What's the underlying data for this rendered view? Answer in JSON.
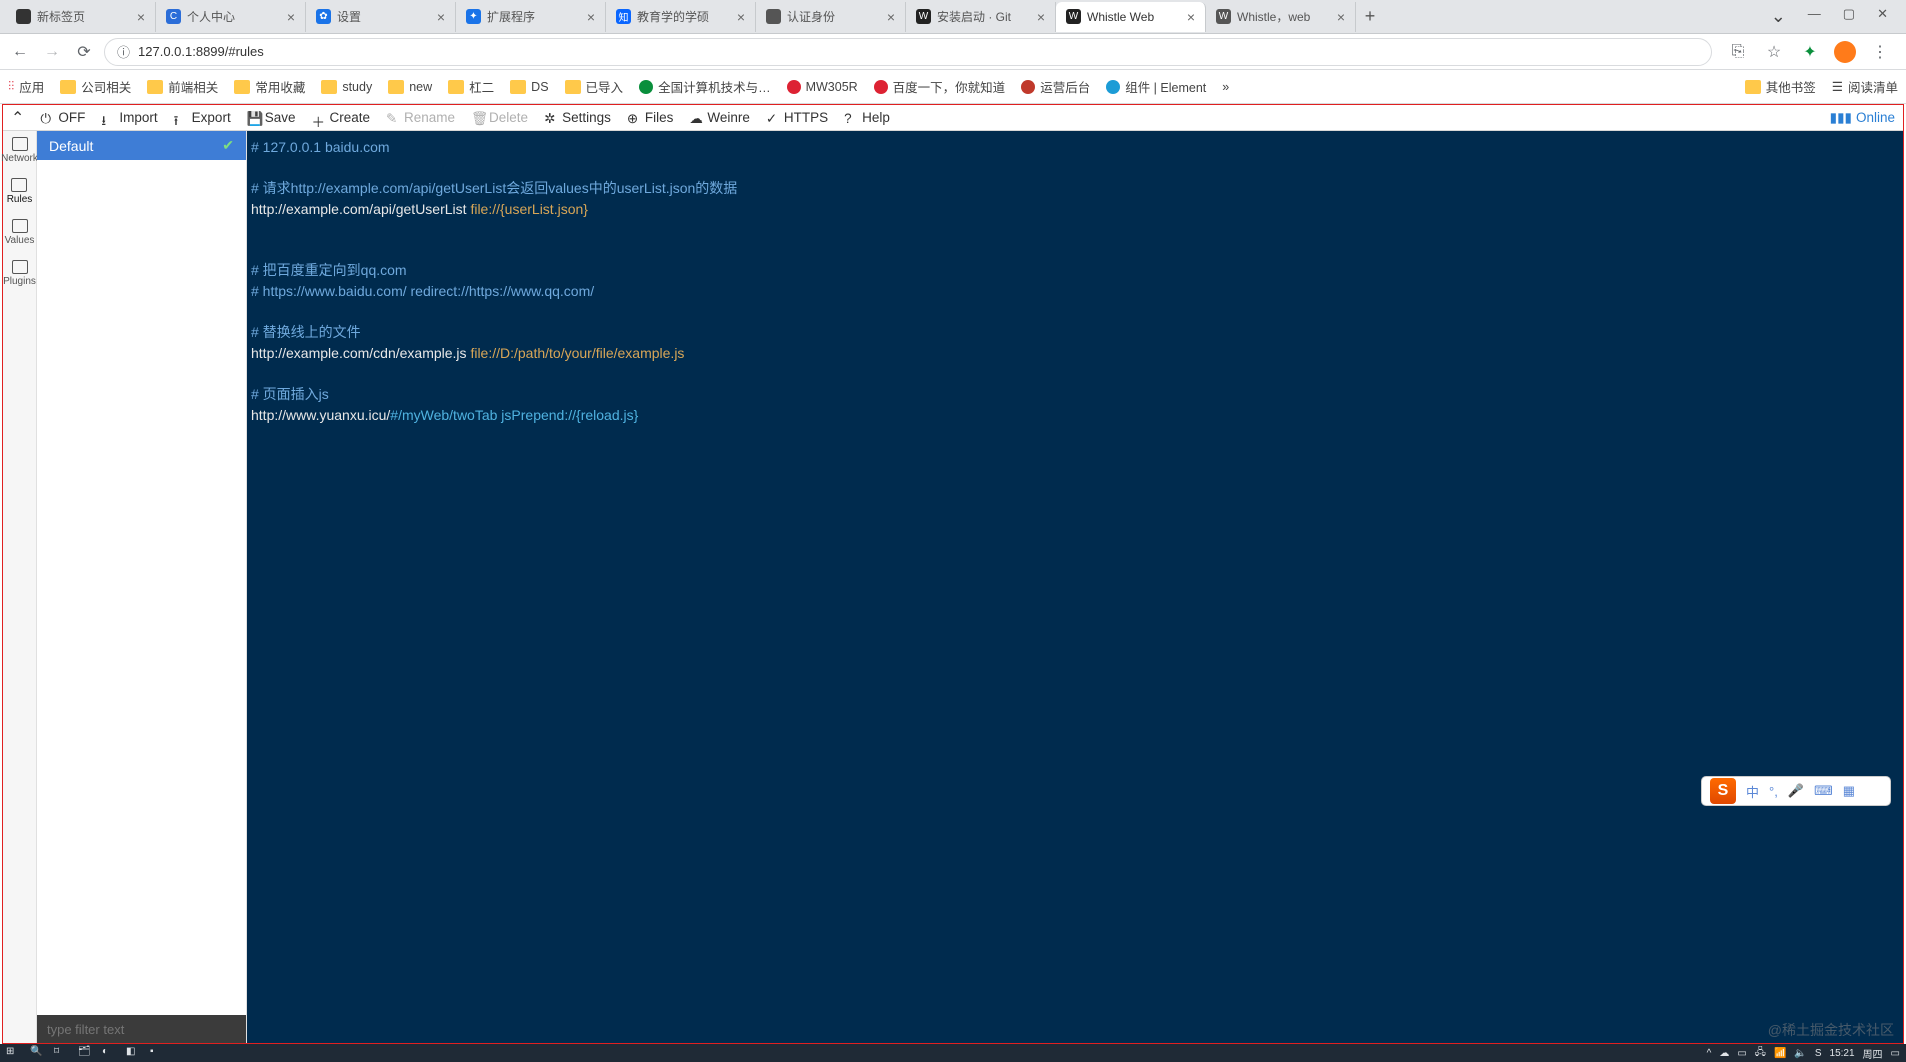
{
  "browser": {
    "tabs": [
      {
        "label": "新标签页",
        "fav_bg": "#333",
        "fav_txt": ""
      },
      {
        "label": "个人中心",
        "fav_bg": "#2b6dd8",
        "fav_txt": "C"
      },
      {
        "label": "设置",
        "fav_bg": "#1a73e8",
        "fav_txt": "✿"
      },
      {
        "label": "扩展程序",
        "fav_bg": "#1a73e8",
        "fav_txt": "✦"
      },
      {
        "label": "教育学的学硕",
        "fav_bg": "#0a66ff",
        "fav_txt": "知"
      },
      {
        "label": "认证身份",
        "fav_bg": "#555",
        "fav_txt": ""
      },
      {
        "label": "安装启动 · Git",
        "fav_bg": "#222",
        "fav_txt": "W"
      },
      {
        "label": "Whistle Web",
        "fav_bg": "#222",
        "fav_txt": "W",
        "active": true
      },
      {
        "label": "Whistle，web",
        "fav_bg": "#555",
        "fav_txt": "W"
      }
    ],
    "url": "127.0.0.1:8899/#rules",
    "bookmarks_left": [
      {
        "label": "应用",
        "type": "apps"
      },
      {
        "label": "公司相关",
        "type": "folder"
      },
      {
        "label": "前端相关",
        "type": "folder"
      },
      {
        "label": "常用收藏",
        "type": "folder"
      },
      {
        "label": "study",
        "type": "folder"
      },
      {
        "label": "new",
        "type": "folder"
      },
      {
        "label": "杠二",
        "type": "folder"
      },
      {
        "label": "DS",
        "type": "folder"
      },
      {
        "label": "已导入",
        "type": "folder"
      },
      {
        "label": "全国计算机技术与…",
        "type": "site",
        "color": "#0a8f3c"
      },
      {
        "label": "MW305R",
        "type": "site",
        "color": "#d23"
      },
      {
        "label": "百度一下，你就知道",
        "type": "site",
        "color": "#d23"
      },
      {
        "label": "运营后台",
        "type": "site",
        "color": "#c0392b"
      },
      {
        "label": "组件 | Element",
        "type": "site",
        "color": "#1c9cd6"
      }
    ],
    "bookmarks_right": [
      {
        "label": "其他书签",
        "type": "folder"
      },
      {
        "label": "阅读清单",
        "type": "list"
      }
    ],
    "overflow": "»"
  },
  "whistle": {
    "toolbar": [
      {
        "key": "off",
        "label": "OFF",
        "enabled": true
      },
      {
        "key": "import",
        "label": "Import",
        "enabled": true
      },
      {
        "key": "export",
        "label": "Export",
        "enabled": true
      },
      {
        "key": "save",
        "label": "Save",
        "enabled": true
      },
      {
        "key": "create",
        "label": "Create",
        "enabled": true
      },
      {
        "key": "rename",
        "label": "Rename",
        "enabled": false
      },
      {
        "key": "delete",
        "label": "Delete",
        "enabled": false
      },
      {
        "key": "settings",
        "label": "Settings",
        "enabled": true
      },
      {
        "key": "files",
        "label": "Files",
        "enabled": true
      },
      {
        "key": "weinre",
        "label": "Weinre",
        "enabled": true
      },
      {
        "key": "https",
        "label": "HTTPS",
        "enabled": true
      },
      {
        "key": "help",
        "label": "Help",
        "enabled": true
      }
    ],
    "online_label": "Online",
    "vtabs": [
      {
        "label": "Network"
      },
      {
        "label": "Rules",
        "active": true
      },
      {
        "label": "Values"
      },
      {
        "label": "Plugins"
      }
    ],
    "rules": [
      {
        "name": "Default",
        "active": true,
        "checked": true
      }
    ],
    "filter_placeholder": "type filter text",
    "editor_lines": [
      {
        "t": "comment",
        "text": "# 127.0.0.1 baidu.com"
      },
      {
        "t": "blank",
        "text": ""
      },
      {
        "t": "comment",
        "text": "# 请求http://example.com/api/getUserList会返回values中的userList.json的数据"
      },
      {
        "t": "rule",
        "url": "http://example.com/api/getUserList ",
        "op": "file://{userList.json}"
      },
      {
        "t": "blank",
        "text": ""
      },
      {
        "t": "blank",
        "text": ""
      },
      {
        "t": "comment",
        "text": "# 把百度重定向到qq.com"
      },
      {
        "t": "comment",
        "text": "# https://www.baidu.com/ redirect://https://www.qq.com/"
      },
      {
        "t": "blank",
        "text": ""
      },
      {
        "t": "comment",
        "text": "# 替换线上的文件"
      },
      {
        "t": "rule",
        "url": "http://example.com/cdn/example.js ",
        "op": "file://D:/path/to/your/file/example.js"
      },
      {
        "t": "blank",
        "text": ""
      },
      {
        "t": "comment",
        "text": "# 页面插入js"
      },
      {
        "t": "rule2",
        "url": "http://www.yuanxu.icu/",
        "op": "#/myWeb/twoTab jsPrepend://{reload.js}"
      }
    ]
  },
  "ime": {
    "lang": "中"
  },
  "watermark": "@稀土掘金技术社区",
  "taskbar": {
    "time": "15:21",
    "day": "周四"
  }
}
